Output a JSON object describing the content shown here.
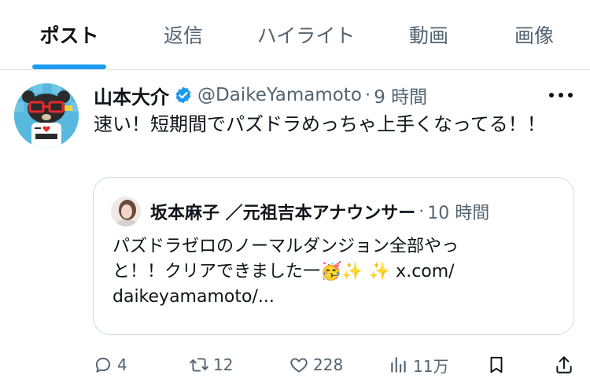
{
  "tabs": [
    {
      "label": "ポスト",
      "active": true
    },
    {
      "label": "返信",
      "active": false
    },
    {
      "label": "ハイライト",
      "active": false
    },
    {
      "label": "動画",
      "active": false
    },
    {
      "label": "画像",
      "active": false
    }
  ],
  "post": {
    "author_name": "山本大介",
    "handle": "@DaikeYamamoto",
    "separator": "·",
    "time": "9 時間",
    "text": "速い！短期間でパズドラめっちゃ上手くなってる！！",
    "avatar_icon": "bear-with-glasses-avatar",
    "verified_icon": "verified-badge-icon",
    "accent_color": "#1d9bf0"
  },
  "quote": {
    "author_name": "坂本麻子 ／元祖吉本アナウンサー",
    "separator": "·",
    "time": "10 時間",
    "text_line1": "パズドラゼロのノーマルダンジョン全部やっ",
    "text_line2_before": "と！！クリアできました一",
    "emoji": "🥳✨ ✨",
    "link_domain": " x.com/",
    "link_path": "daikeyamamoto/..."
  },
  "actions": {
    "reply": {
      "icon": "reply-icon",
      "count": "4"
    },
    "repost": {
      "icon": "repost-icon",
      "count": "12"
    },
    "like": {
      "icon": "heart-icon",
      "count": "228"
    },
    "views": {
      "icon": "views-chart-icon",
      "count": "11万"
    },
    "bookmark": {
      "icon": "bookmark-icon"
    },
    "share": {
      "icon": "share-icon"
    }
  }
}
